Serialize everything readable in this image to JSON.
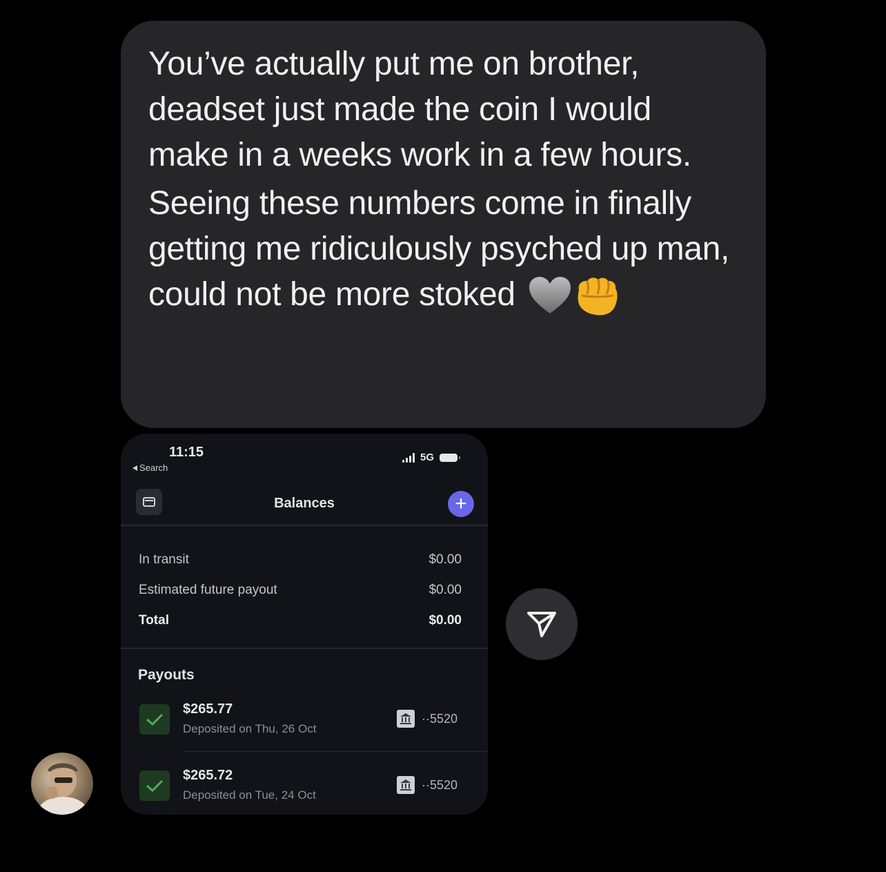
{
  "message": {
    "paragraph1": "You’ve actually put me on brother, deadset just made the coin I would make in a weeks work in a few hours.",
    "paragraph2": "Seeing these numbers come in finally getting me ridiculously psyched up man, could not be more stoked",
    "emojis": [
      "grey-heart-icon",
      "fist-bump-icon"
    ]
  },
  "screenshot": {
    "status_time": "11:15",
    "back_label": "Search",
    "network": "5G",
    "title": "Balances",
    "balances": [
      {
        "label": "In transit",
        "value": "$0.00"
      },
      {
        "label": "Estimated future payout",
        "value": "$0.00"
      },
      {
        "label": "Total",
        "value": "$0.00"
      }
    ],
    "payouts_title": "Payouts",
    "payouts": [
      {
        "amount": "$265.77",
        "date": "Deposited on Thu, 26 Oct",
        "account": "··5520"
      },
      {
        "amount": "$265.72",
        "date": "Deposited on Tue, 24 Oct",
        "account": "··5520"
      }
    ]
  },
  "colors": {
    "bubble": "#262628",
    "accent": "#6a66e8",
    "check": "#4caf50"
  }
}
